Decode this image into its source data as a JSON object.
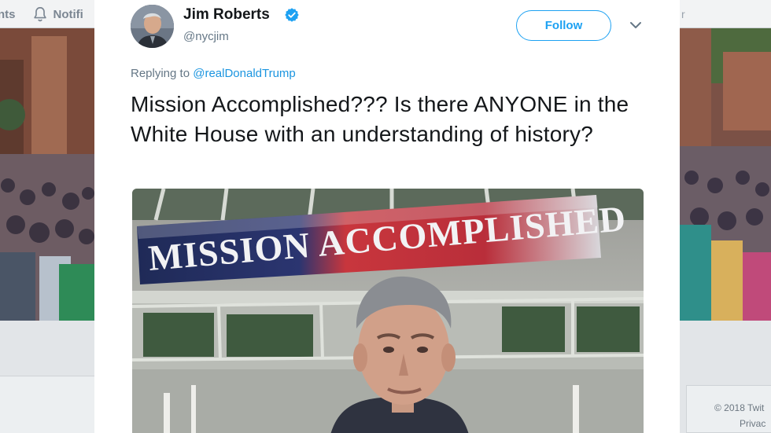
{
  "background": {
    "nav": {
      "item_partial_1": "nts",
      "item_partial_2": "Notifi",
      "right_partial": "r"
    },
    "footer": {
      "line1": "© 2018 Twit",
      "line2": "Privac"
    }
  },
  "tweet": {
    "author": {
      "name": "Jim Roberts",
      "handle": "@nycjim",
      "verified": true
    },
    "follow_label": "Follow",
    "reply_prefix": "Replying to",
    "reply_to": "@realDonaldTrump",
    "text": "Mission Accomplished??? Is there ANYONE in the White House with an understanding of history?",
    "media": {
      "banner_text": "MISSION ACCOMPLISHED"
    }
  },
  "colors": {
    "accent": "#1da1f2",
    "link": "#1b95e0",
    "text": "#14171a",
    "secondary": "#657786"
  },
  "icons": {
    "notifications": "bell-icon",
    "verified": "verified-badge-icon",
    "more": "chevron-down-icon"
  }
}
